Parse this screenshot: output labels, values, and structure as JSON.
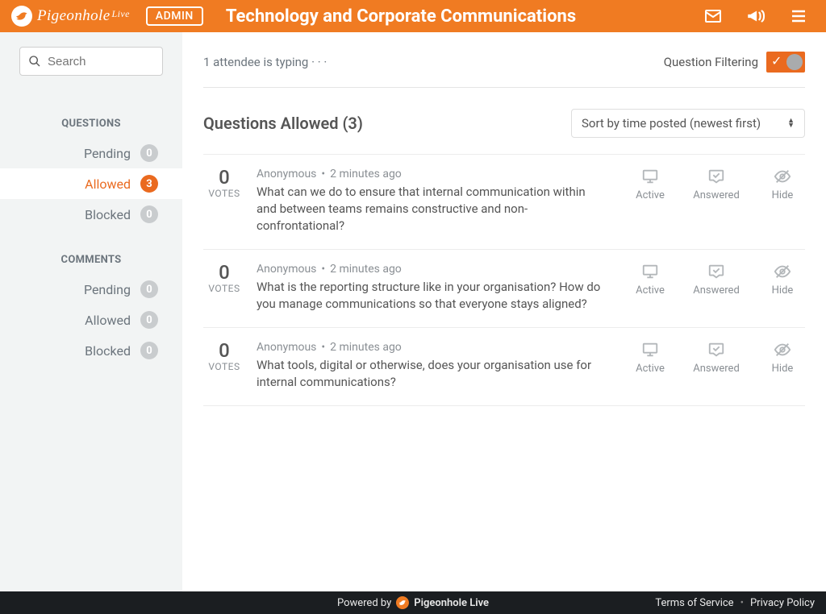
{
  "header": {
    "brand": "Pigeonhole",
    "brand_suffix": "Live",
    "admin_label": "ADMIN",
    "title": "Technology and Corporate Communications"
  },
  "sidebar": {
    "search_placeholder": "Search",
    "sections": {
      "questions": {
        "heading": "QUESTIONS",
        "items": [
          {
            "label": "Pending",
            "count": "0",
            "active": false
          },
          {
            "label": "Allowed",
            "count": "3",
            "active": true
          },
          {
            "label": "Blocked",
            "count": "0",
            "active": false
          }
        ]
      },
      "comments": {
        "heading": "COMMENTS",
        "items": [
          {
            "label": "Pending",
            "count": "0",
            "active": false
          },
          {
            "label": "Allowed",
            "count": "0",
            "active": false
          },
          {
            "label": "Blocked",
            "count": "0",
            "active": false
          }
        ]
      }
    }
  },
  "status": {
    "typing_text": "1 attendee is typing · · ·",
    "filter_label": "Question Filtering",
    "filter_on": true
  },
  "list": {
    "title": "Questions Allowed (3)",
    "sort_label": "Sort by time posted (newest first)",
    "votes_label": "VOTES",
    "actions": {
      "active": "Active",
      "answered": "Answered",
      "hide": "Hide"
    }
  },
  "questions": [
    {
      "votes": "0",
      "author": "Anonymous",
      "time": "2 minutes ago",
      "text": "What can we do to ensure that internal communication within and between teams remains constructive and non-confrontational?"
    },
    {
      "votes": "0",
      "author": "Anonymous",
      "time": "2 minutes ago",
      "text": "What is the reporting structure like in your organisation? How do you manage communications so that everyone stays aligned?"
    },
    {
      "votes": "0",
      "author": "Anonymous",
      "time": "2 minutes ago",
      "text": "What tools, digital or otherwise, does your organisation use for internal communications?"
    }
  ],
  "footer": {
    "powered_by": "Powered by",
    "brand": "Pigeonhole Live",
    "terms": "Terms of Service",
    "privacy": "Privacy Policy"
  }
}
